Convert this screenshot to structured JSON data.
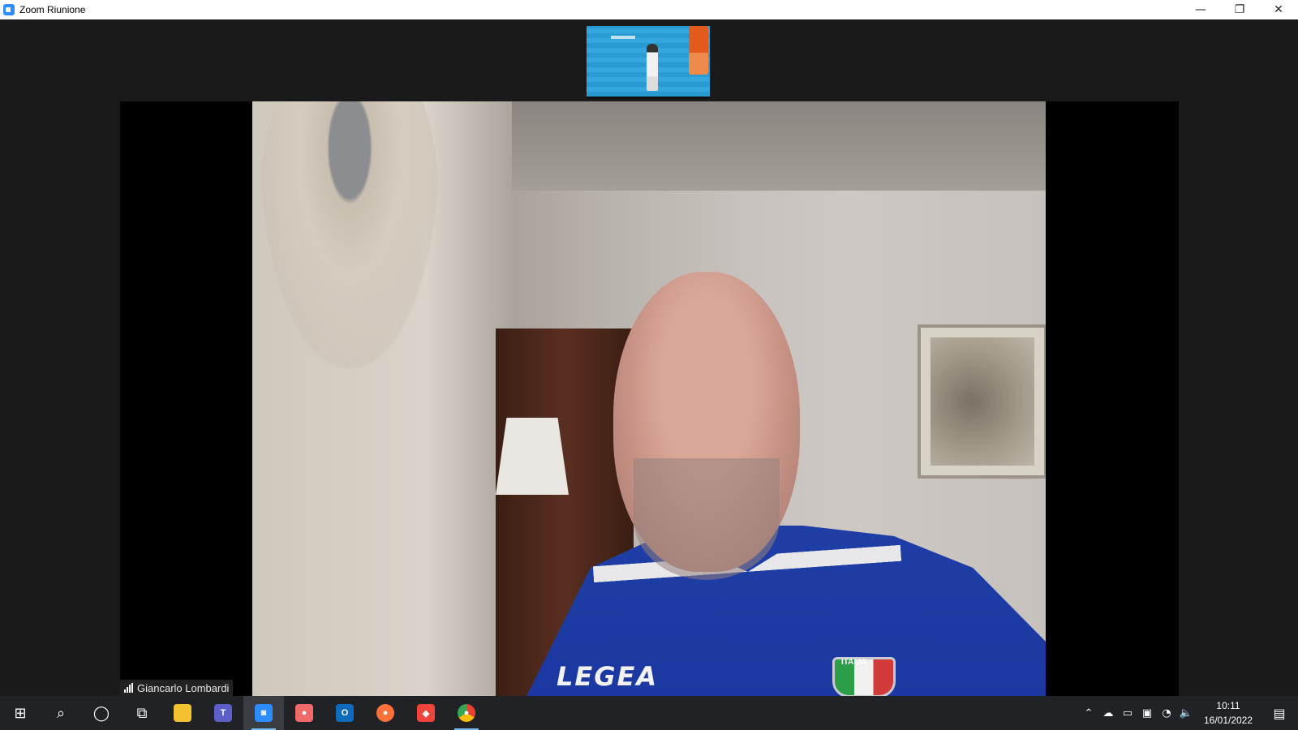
{
  "window": {
    "title": "Zoom Riunione",
    "controls": {
      "minimize": "—",
      "restore": "❐",
      "close": "✕"
    }
  },
  "meeting": {
    "thumbnail_icon": "shared-video-thumbnail",
    "active_speaker": {
      "name": "Giancarlo Lombardi",
      "signal_icon": "signal-bars-icon"
    },
    "jersey_text": "LEGEA",
    "crest_text": "ITALIA"
  },
  "taskbar": {
    "start": {
      "icon": "windows-start-icon",
      "glyph": "⊞"
    },
    "search": {
      "icon": "search-icon",
      "glyph": "⌕"
    },
    "cortana": {
      "icon": "cortana-icon",
      "glyph": "◯"
    },
    "task_view": {
      "icon": "task-view-icon",
      "glyph": "⧉"
    },
    "apps": [
      {
        "name": "file-explorer",
        "label": "",
        "color": "#f2c230"
      },
      {
        "name": "teams",
        "label": "T",
        "color": "#5b5fc7"
      },
      {
        "name": "zoom",
        "label": "◙",
        "color": "#2d8cff"
      },
      {
        "name": "asana",
        "label": "●",
        "color": "#f06a6a"
      },
      {
        "name": "outlook",
        "label": "O",
        "color": "#0f6cbd"
      },
      {
        "name": "firefox",
        "label": "●",
        "color": "#ff7139"
      },
      {
        "name": "anydesk",
        "label": "◆",
        "color": "#ef443b"
      },
      {
        "name": "chrome",
        "label": "●",
        "color": "#34a853"
      }
    ],
    "tray": {
      "chevron": "⌃",
      "onedrive": "☁",
      "battery": "▭",
      "meet": "▣",
      "wifi": "◔",
      "volume": "🔈",
      "time": "10:11",
      "date": "16/01/2022",
      "notifications": "▤"
    }
  },
  "colors": {
    "accent": "#2d8cff",
    "taskbar": "#202225",
    "background": "#1a1a1a"
  }
}
